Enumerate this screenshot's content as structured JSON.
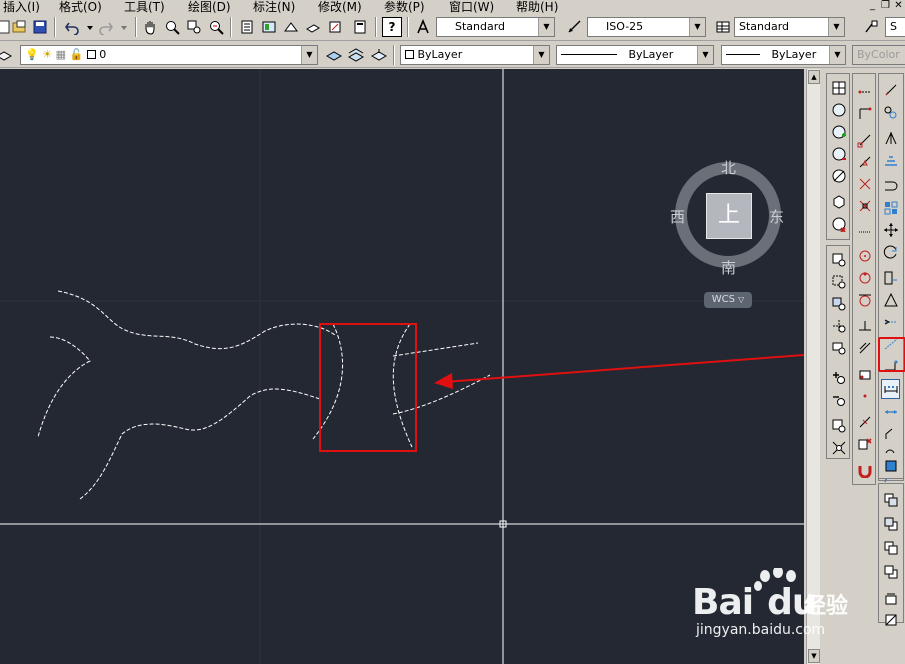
{
  "menu": {
    "items": [
      "插入(I)",
      "格式(O)",
      "工具(T)",
      "绘图(D)",
      "标注(N)",
      "修改(M)",
      "参数(P)",
      "窗口(W)",
      "帮助(H)"
    ]
  },
  "toolbar_styles": {
    "text_style": "Standard",
    "dim_style": "ISO-25",
    "table_style": "Standard",
    "last_combo_partial": "S"
  },
  "layers": {
    "current_layer": "0",
    "color": "ByLayer",
    "linetype": "ByLayer",
    "lineweight": "ByLayer",
    "plot_style": "ByColor"
  },
  "viewcube": {
    "north": "北",
    "south": "南",
    "east": "东",
    "west": "西",
    "face": "上",
    "wcs": "WCS"
  },
  "watermark": {
    "brand": "Bai",
    "brand_tail": "du",
    "subtitle": "经验",
    "url": "jingyan.baidu.com"
  },
  "colors": {
    "canvas_bg": "#232832",
    "highlight_red": "#e01010",
    "line_white": "#ffffff"
  },
  "icons": {
    "toolbar_row1": [
      "new-icon",
      "open-icon",
      "save-icon",
      "undo-icon",
      "redo-icon",
      "pan-icon",
      "zoom-realtime-icon",
      "zoom-window-icon",
      "zoom-previous-icon",
      "properties-icon",
      "design-center-icon",
      "tool-palettes-icon",
      "sheet-set-icon",
      "markup-icon",
      "calculator-icon",
      "help-icon",
      "text-style-icon",
      "dim-style-icon",
      "table-style-icon",
      "multileader-style-icon"
    ],
    "dimension_toolbar_highlighted": "dim-continue-icon"
  }
}
